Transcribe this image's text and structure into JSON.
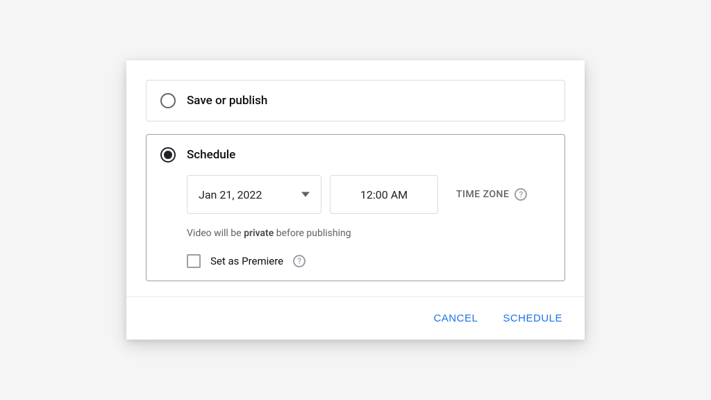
{
  "options": {
    "save_publish": {
      "label": "Save or publish",
      "selected": false
    },
    "schedule": {
      "label": "Schedule",
      "selected": true
    }
  },
  "schedule": {
    "date": "Jan 21, 2022",
    "time": "12:00 AM",
    "timezone_label": "TIME ZONE",
    "note_prefix": "Video will be ",
    "note_bold": "private",
    "note_suffix": " before publishing",
    "premiere_label": "Set as Premiere",
    "premiere_checked": false
  },
  "footer": {
    "cancel": "CANCEL",
    "schedule": "SCHEDULE"
  }
}
